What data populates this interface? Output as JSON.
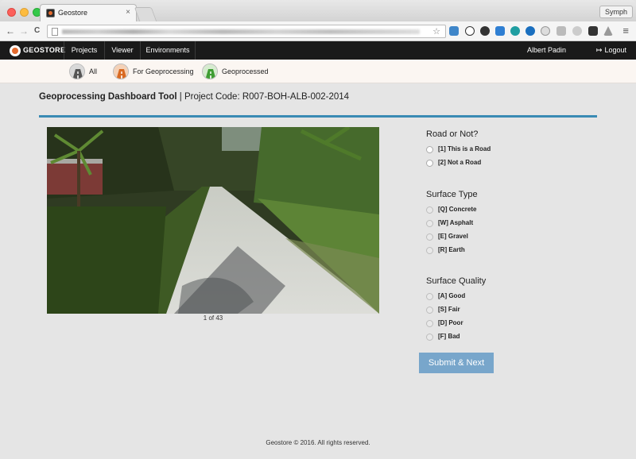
{
  "browser": {
    "tab_title": "Geostore",
    "tab_close": "×",
    "profile": "Symph",
    "back": "←",
    "forward": "→",
    "reload": "C",
    "star": "☆",
    "menu": "≡"
  },
  "navbar": {
    "brand": "GEOSTORE",
    "links": [
      "Projects",
      "Viewer",
      "Environments"
    ],
    "user": "Albert Padin",
    "logout": "Logout",
    "logout_icon": "↦"
  },
  "filters": [
    "All",
    "For Geoprocessing",
    "Geoprocessed"
  ],
  "page": {
    "title_bold": "Geoprocessing Dashboard Tool",
    "title_rest": " | Project Code: R007-BOH-ALB-002-2014",
    "counter": "1 of 43"
  },
  "questions": [
    {
      "title": "Road or Not?",
      "options": [
        "[1] This is a Road",
        "[2] Not a Road"
      ]
    },
    {
      "title": "Surface Type",
      "options": [
        "[Q] Concrete",
        "[W] Asphalt",
        "[E] Gravel",
        "[R] Earth"
      ]
    },
    {
      "title": "Surface Quality",
      "options": [
        "[A] Good",
        "[S] Fair",
        "[D] Poor",
        "[F] Bad"
      ]
    }
  ],
  "submit_label": "Submit & Next",
  "footer": "Geostore © 2016. All rights reserved.",
  "colors": {
    "navbar_bg": "#1a1a1a",
    "accent_rule": "#3a8bb4",
    "submit_bg": "#78a6cb",
    "page_bg": "#e5e5e5",
    "filterbar_bg": "#fbf6f2"
  }
}
